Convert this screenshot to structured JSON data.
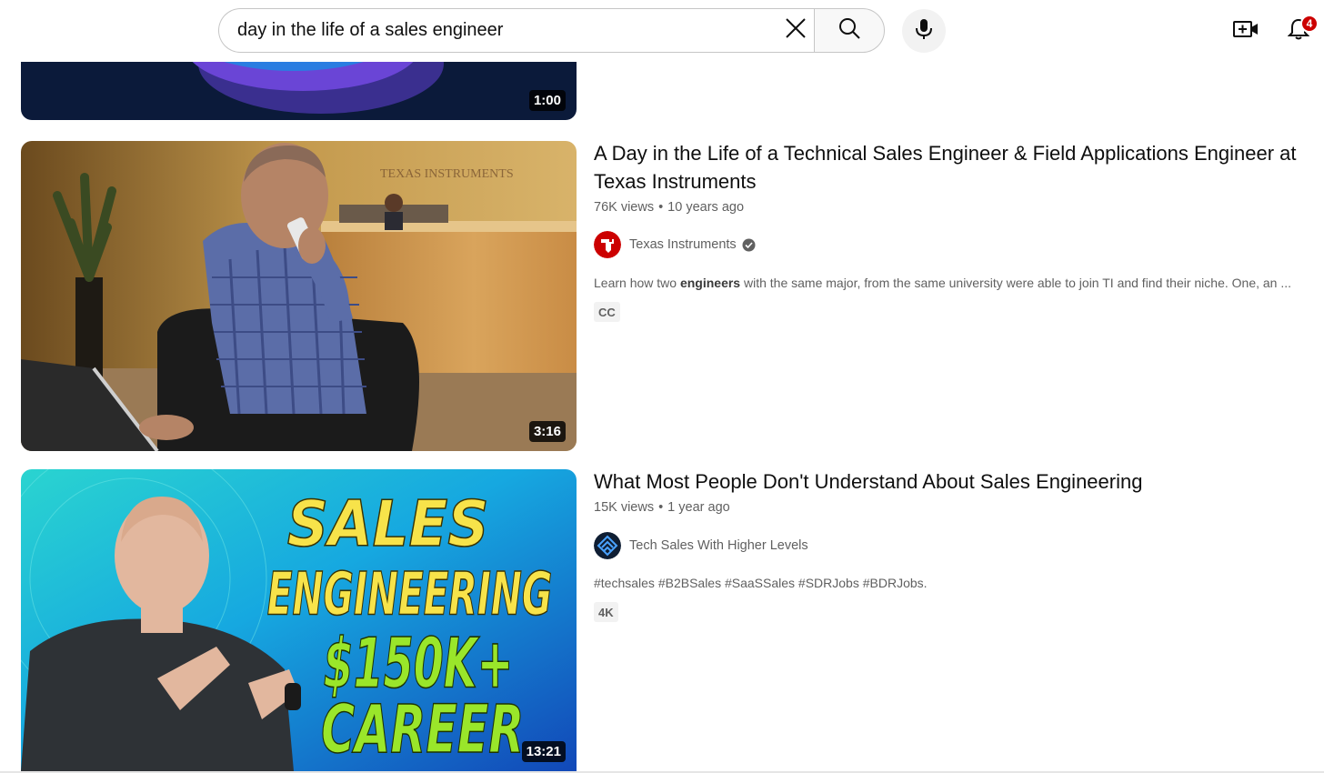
{
  "search": {
    "query": "day in the life of a sales engineer",
    "icons": {
      "clear": "close-icon",
      "search": "search-icon",
      "mic": "mic-icon"
    }
  },
  "header": {
    "create_icon": "video-plus-icon",
    "notifications_icon": "bell-icon",
    "notification_count": "4",
    "badge_color": "#cc0000"
  },
  "results": [
    {
      "duration": "1:00"
    },
    {
      "title": "A Day in the Life of a Technical Sales Engineer & Field Applications Engineer at Texas Instruments",
      "views": "76K views",
      "age": "10 years ago",
      "channel": "Texas Instruments",
      "verified": true,
      "desc_before": "Learn how two ",
      "desc_bold": "engineers",
      "desc_after": " with the same major, from the same university were able to join TI and find their niche. One, an ...",
      "badge": "CC",
      "duration": "3:16",
      "thumbnail_wall_text": "TEXAS INSTRUMENTS"
    },
    {
      "title": "What Most People Don't Understand About Sales Engineering",
      "views": "15K views",
      "age": "1 year ago",
      "channel": "Tech Sales With Higher Levels",
      "desc": "#techsales #B2BSales #SaaSSales #SDRJobs #BDRJobs.",
      "badge": "4K",
      "duration": "13:21",
      "thumbnail_text": {
        "line1": "SALES",
        "line2": "ENGINEERING",
        "line3": "$150K+",
        "line4": "CAREER"
      }
    }
  ],
  "colors": {
    "text_primary": "#0f0f0f",
    "text_secondary": "#606060",
    "ti_red": "#cc0000",
    "thumb3_yellow": "#f7e34a",
    "thumb3_green": "#9ae62a"
  }
}
